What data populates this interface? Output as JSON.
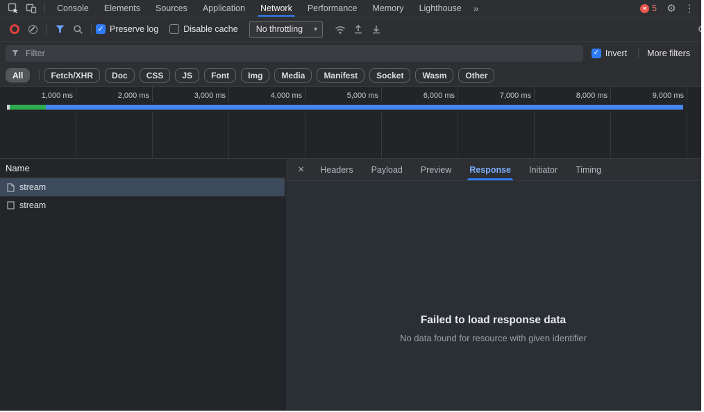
{
  "main_tabs": {
    "items": [
      "Console",
      "Elements",
      "Sources",
      "Application",
      "Network",
      "Performance",
      "Memory",
      "Lighthouse"
    ],
    "active": "Network",
    "error_count": "5"
  },
  "toolbar": {
    "preserve_log_label": "Preserve log",
    "disable_cache_label": "Disable cache",
    "throttling_value": "No throttling"
  },
  "filter_bar": {
    "placeholder": "Filter",
    "invert_label": "Invert",
    "more_filters_label": "More filters"
  },
  "filter_chips": {
    "items": [
      "All",
      "Fetch/XHR",
      "Doc",
      "CSS",
      "JS",
      "Font",
      "Img",
      "Media",
      "Manifest",
      "Socket",
      "Wasm",
      "Other"
    ],
    "active": "All"
  },
  "timeline": {
    "tick_labels": [
      "1,000 ms",
      "2,000 ms",
      "3,000 ms",
      "4,000 ms",
      "5,000 ms",
      "6,000 ms",
      "7,000 ms",
      "8,000 ms",
      "9,000 ms"
    ]
  },
  "requests": {
    "name_header": "Name",
    "rows": [
      {
        "name": "stream",
        "selected": true
      },
      {
        "name": "stream",
        "selected": false
      }
    ]
  },
  "detail_panel": {
    "tabs": [
      "Headers",
      "Payload",
      "Preview",
      "Response",
      "Initiator",
      "Timing"
    ],
    "active_tab": "Response",
    "empty_title": "Failed to load response data",
    "empty_subtitle": "No data found for resource with given identifier"
  },
  "icons": {
    "gear": "⚙",
    "kebab": "⋮",
    "overflow": "»",
    "close": "×",
    "error_x": "×",
    "caret": "▾",
    "check": "✓"
  },
  "colors": {
    "accent_blue": "#7cacf8",
    "checkbox_blue": "#2f7bf5",
    "bar_blue": "#4585f0",
    "bar_green": "#2eab4f",
    "error_red": "#e8564d",
    "selected_row": "#3d4a5c"
  }
}
